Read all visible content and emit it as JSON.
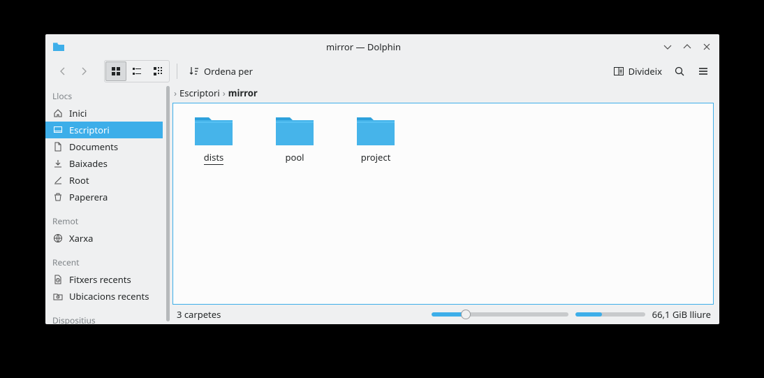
{
  "window": {
    "title": "mirror — Dolphin"
  },
  "toolbar": {
    "sort_label": "Ordena per",
    "split_label": "Divideix"
  },
  "sidebar": {
    "sections": {
      "places": "Llocs",
      "remote": "Remot",
      "recent": "Recent",
      "devices": "Dispositius"
    },
    "places_items": [
      {
        "label": "Inici"
      },
      {
        "label": "Escriptori"
      },
      {
        "label": "Documents"
      },
      {
        "label": "Baixades"
      },
      {
        "label": "Root"
      },
      {
        "label": "Paperera"
      }
    ],
    "remote_items": [
      {
        "label": "Xarxa"
      }
    ],
    "recent_items": [
      {
        "label": "Fitxers recents"
      },
      {
        "label": "Ubicacions recents"
      }
    ]
  },
  "breadcrumb": {
    "segments": [
      {
        "label": "Escriptori"
      },
      {
        "label": "mirror"
      }
    ]
  },
  "files": [
    {
      "name": "dists"
    },
    {
      "name": "pool"
    },
    {
      "name": "project"
    }
  ],
  "status": {
    "count_text": "3 carpetes",
    "free_space": "66,1 GiB lliure",
    "zoom_percent": 25,
    "disk_used_percent": 38
  }
}
